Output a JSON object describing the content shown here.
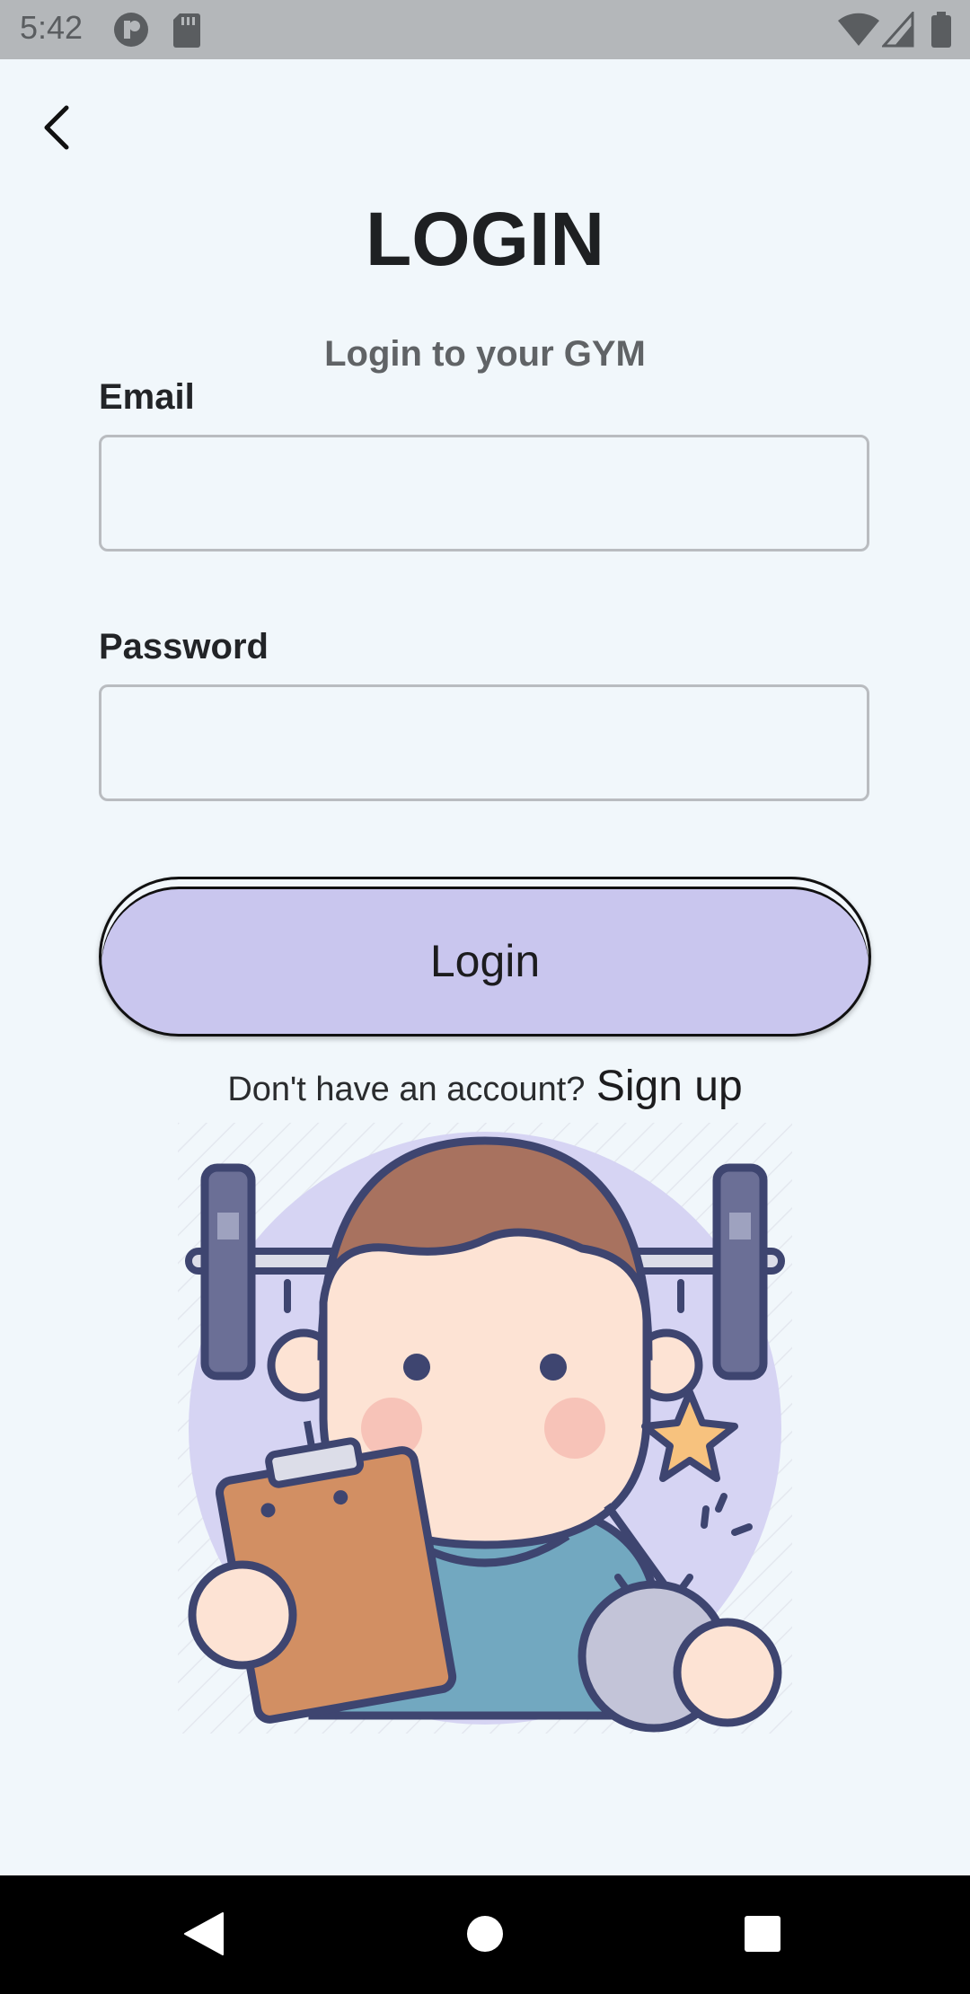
{
  "status_bar": {
    "time": "5:42",
    "icons": [
      "record-icon",
      "sd-card-icon",
      "wifi-icon",
      "signal-icon",
      "battery-icon"
    ]
  },
  "header": {
    "back_icon": "arrow-back-icon",
    "title": "LOGIN",
    "subtitle": "Login to your GYM"
  },
  "form": {
    "email_label": "Email",
    "email_value": "",
    "password_label": "Password",
    "password_value": "",
    "login_button": "Login"
  },
  "signup": {
    "prompt": "Don't have an account?",
    "link": "Sign up"
  },
  "illustration": {
    "icon": "gym-trainer-illustration"
  },
  "nav_bar": {
    "back": "nav-back-icon",
    "home": "nav-home-icon",
    "recents": "nav-recents-icon"
  },
  "colors": {
    "background": "#f1f7fb",
    "button_fill": "#c9c6ee",
    "status_bar": "#b4b7ba"
  }
}
